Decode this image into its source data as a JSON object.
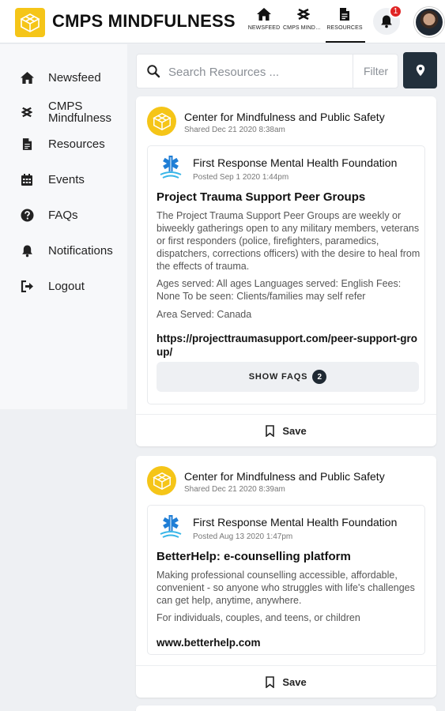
{
  "app": {
    "title": "CMPS MINDFULNESS",
    "brand_color": "#f5c518",
    "notification_count": "1"
  },
  "topnav": [
    {
      "label": "NEWSFEED",
      "icon": "home-icon"
    },
    {
      "label": "CMPS MINDFULNESS",
      "icon": "mindfulness-icon"
    },
    {
      "label": "RESOURCES",
      "icon": "document-icon",
      "active": true
    }
  ],
  "sidebar": {
    "items": [
      {
        "label": "Newsfeed",
        "icon": "home-icon"
      },
      {
        "label": "CMPS Mindfulness",
        "icon": "mindfulness-icon"
      },
      {
        "label": "Resources",
        "icon": "document-icon"
      },
      {
        "label": "Events",
        "icon": "calendar-icon"
      },
      {
        "label": "FAQs",
        "icon": "question-icon"
      },
      {
        "label": "Notifications",
        "icon": "bell-icon"
      },
      {
        "label": "Logout",
        "icon": "logout-icon"
      }
    ]
  },
  "search": {
    "placeholder": "Search Resources ...",
    "filter_label": "Filter"
  },
  "posts": [
    {
      "org_name": "Center for Mindfulness and Public Safety",
      "shared": "Shared Dec 21 2020 8:38am",
      "resource": {
        "provider": "First Response Mental Health Foundation",
        "posted": "Posted Sep 1 2020 1:44pm",
        "title": "Project Trauma Support Peer Groups",
        "description": "The Project Trauma Support Peer Groups are weekly or biweekly gatherings open to any military members, veterans or first responders (police, firefighters, paramedics, dispatchers, corrections officers) with the desire to heal from the effects of trauma.",
        "details": "Ages served: All ages Languages served: English Fees: None To be seen: Clients/families may self refer",
        "area": "Area Served: Canada",
        "link": "https://projecttraumasupport.com/peer-support-group/",
        "faq_label": "SHOW FAQS",
        "faq_count": "2"
      },
      "save_label": "Save"
    },
    {
      "org_name": "Center for Mindfulness and Public Safety",
      "shared": "Shared Dec 21 2020 8:39am",
      "resource": {
        "provider": "First Response Mental Health Foundation",
        "posted": "Posted Aug 13 2020 1:47pm",
        "title": "BetterHelp: e-counselling platform",
        "description": "Making professional counselling accessible, affordable, convenient - so anyone who struggles with life's challenges can get help, anytime, anywhere.",
        "details": "For individuals, couples, and teens, or children",
        "link": "www.betterhelp.com"
      },
      "save_label": "Save"
    }
  ]
}
